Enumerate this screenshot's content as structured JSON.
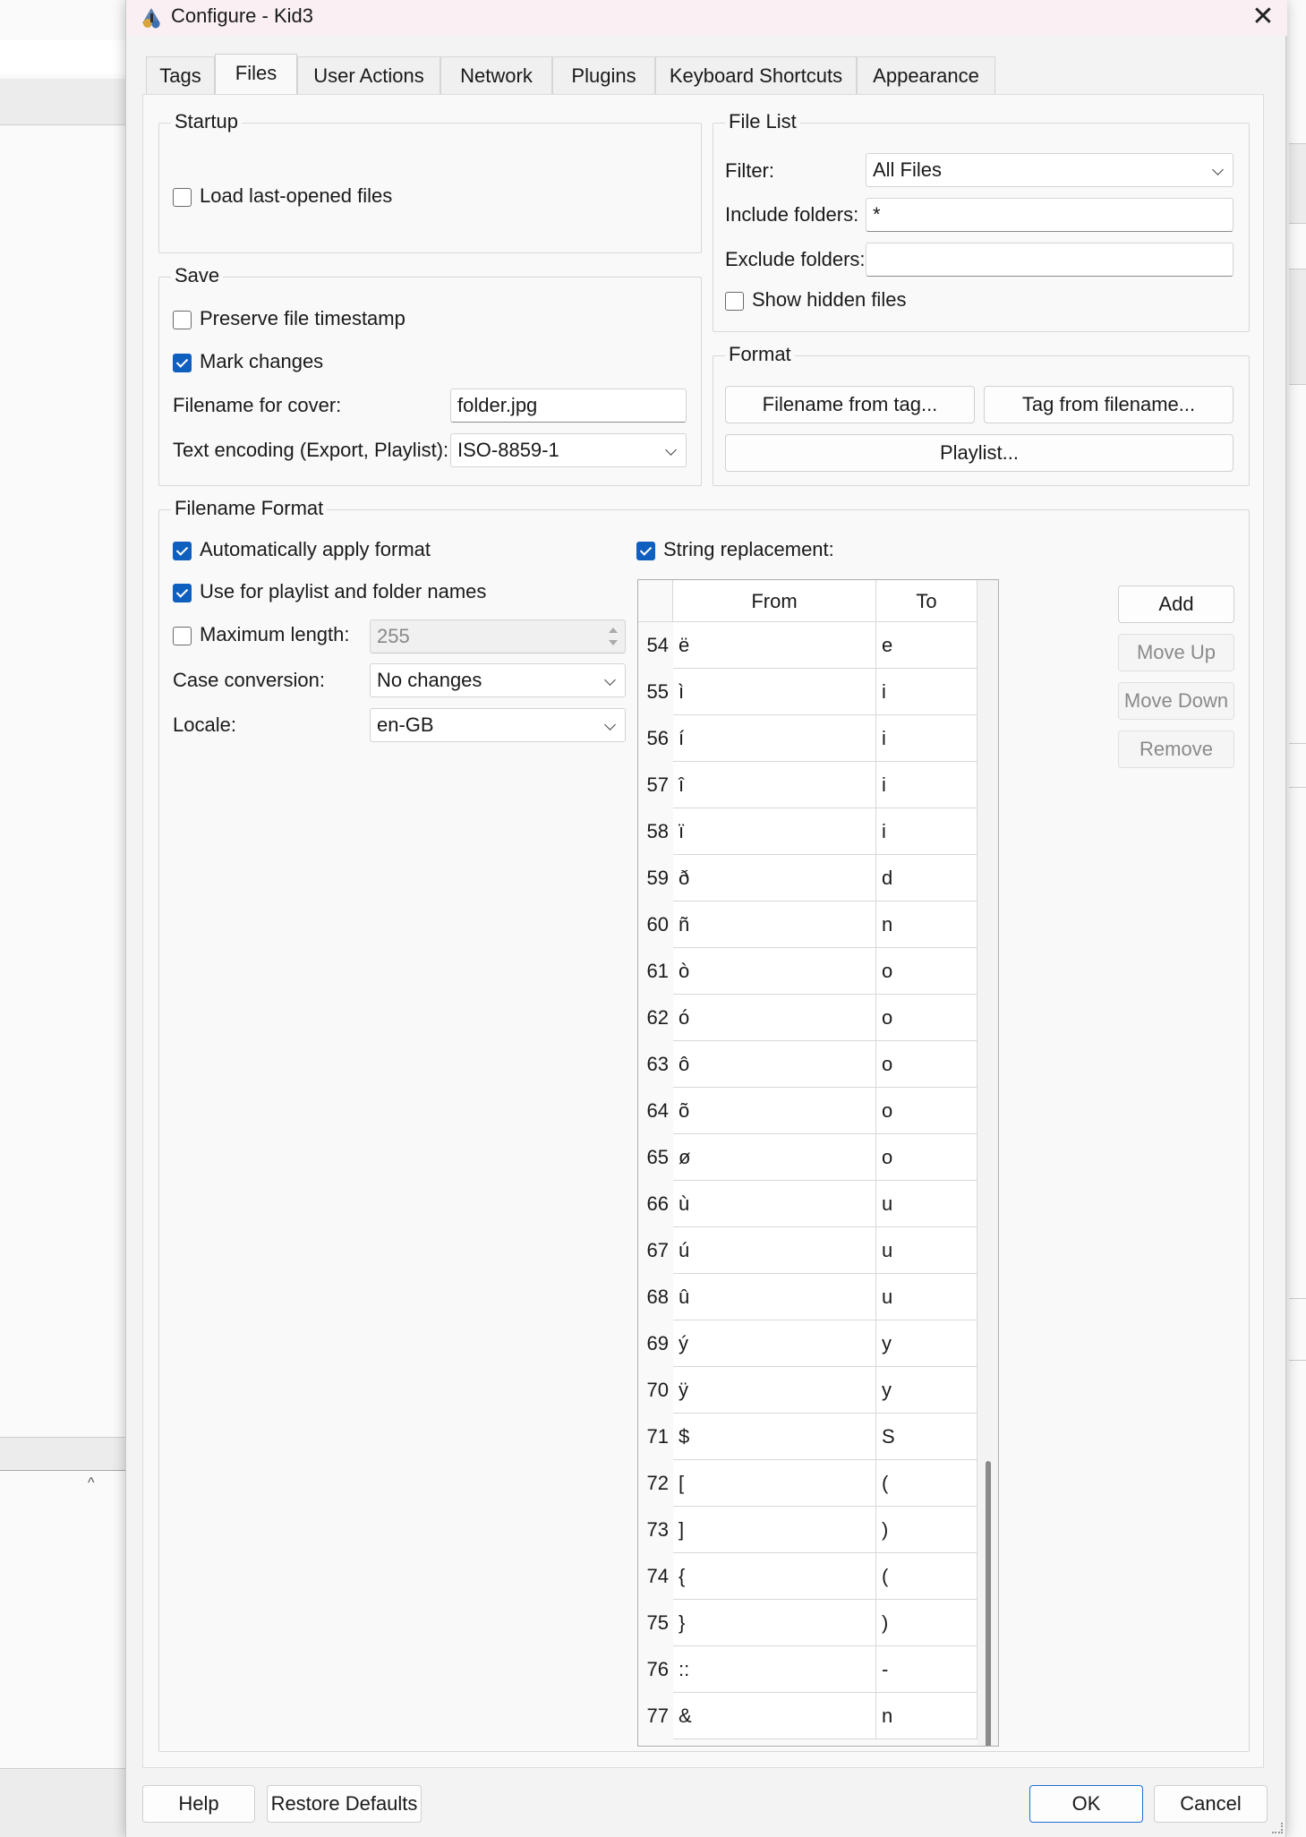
{
  "window": {
    "title": "Configure - Kid3",
    "close_glyph": "✕"
  },
  "tabs": [
    "Tags",
    "Files",
    "User Actions",
    "Network",
    "Plugins",
    "Keyboard Shortcuts",
    "Appearance"
  ],
  "active_tab": "Files",
  "startup": {
    "title": "Startup",
    "load_last_opened_label": "Load last-opened files",
    "load_last_opened_checked": false
  },
  "save": {
    "title": "Save",
    "preserve_timestamp_label": "Preserve file timestamp",
    "preserve_timestamp_checked": false,
    "mark_changes_label": "Mark changes",
    "mark_changes_checked": true,
    "cover_label": "Filename for cover:",
    "cover_value": "folder.jpg",
    "encoding_label": "Text encoding (Export, Playlist):",
    "encoding_value": "ISO-8859-1"
  },
  "file_list": {
    "title": "File List",
    "filter_label": "Filter:",
    "filter_value": "All Files",
    "include_label": "Include folders:",
    "include_value": "*",
    "exclude_label": "Exclude folders:",
    "exclude_value": "",
    "show_hidden_label": "Show hidden files",
    "show_hidden_checked": false
  },
  "format": {
    "title": "Format",
    "filename_from_tag_label": "Filename from tag...",
    "tag_from_filename_label": "Tag from filename...",
    "playlist_label": "Playlist..."
  },
  "filename_format": {
    "title": "Filename Format",
    "auto_apply_label": "Automatically apply format",
    "auto_apply_checked": true,
    "playlist_folder_label": "Use for playlist and folder names",
    "playlist_folder_checked": true,
    "max_length_label": "Maximum length:",
    "max_length_checked": false,
    "max_length_value": "255",
    "case_label": "Case conversion:",
    "case_value": "No changes",
    "locale_label": "Locale:",
    "locale_value": "en-GB",
    "string_replacement_label": "String replacement:",
    "string_replacement_checked": true
  },
  "replacement_table": {
    "headers": [
      "From",
      "To"
    ],
    "rows": [
      [
        "54",
        "ë",
        "e"
      ],
      [
        "55",
        "ì",
        "i"
      ],
      [
        "56",
        "í",
        "i"
      ],
      [
        "57",
        "î",
        "i"
      ],
      [
        "58",
        "ï",
        "i"
      ],
      [
        "59",
        "ð",
        "d"
      ],
      [
        "60",
        "ñ",
        "n"
      ],
      [
        "61",
        "ò",
        "o"
      ],
      [
        "62",
        "ó",
        "o"
      ],
      [
        "63",
        "ô",
        "o"
      ],
      [
        "64",
        "õ",
        "o"
      ],
      [
        "65",
        "ø",
        "o"
      ],
      [
        "66",
        "ù",
        "u"
      ],
      [
        "67",
        "ú",
        "u"
      ],
      [
        "68",
        "û",
        "u"
      ],
      [
        "69",
        "ý",
        "y"
      ],
      [
        "70",
        "ÿ",
        "y"
      ],
      [
        "71",
        "$",
        "S"
      ],
      [
        "72",
        "[",
        "("
      ],
      [
        "73",
        "]",
        ")"
      ],
      [
        "74",
        "{",
        "("
      ],
      [
        "75",
        "}",
        ")"
      ],
      [
        "76",
        "::",
        "-"
      ],
      [
        "77",
        "&",
        "n"
      ]
    ]
  },
  "table_buttons": {
    "add": "Add",
    "move_up": "Move Up",
    "move_down": "Move Down",
    "remove": "Remove"
  },
  "footer": {
    "help": "Help",
    "restore_defaults": "Restore Defaults",
    "ok": "OK",
    "cancel": "Cancel"
  },
  "colors": {
    "accent": "#0f5fbf",
    "titlebar": "#faf0f3"
  }
}
